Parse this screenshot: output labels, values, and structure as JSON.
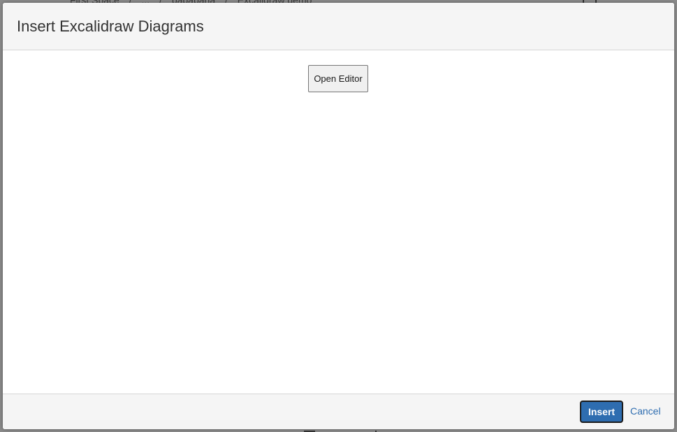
{
  "background_page": {
    "breadcrumb": [
      "First Space",
      "/",
      "...",
      "/",
      "bababana",
      "/",
      "Excalidraw demo"
    ]
  },
  "dialog": {
    "title": "Insert Excalidraw Diagrams",
    "open_editor_label": "Open Editor",
    "insert_label": "Insert",
    "cancel_label": "Cancel"
  },
  "colors": {
    "primary": "#2e6db0",
    "header_bg": "#f5f5f5",
    "overlay": "#8a8a8a"
  }
}
